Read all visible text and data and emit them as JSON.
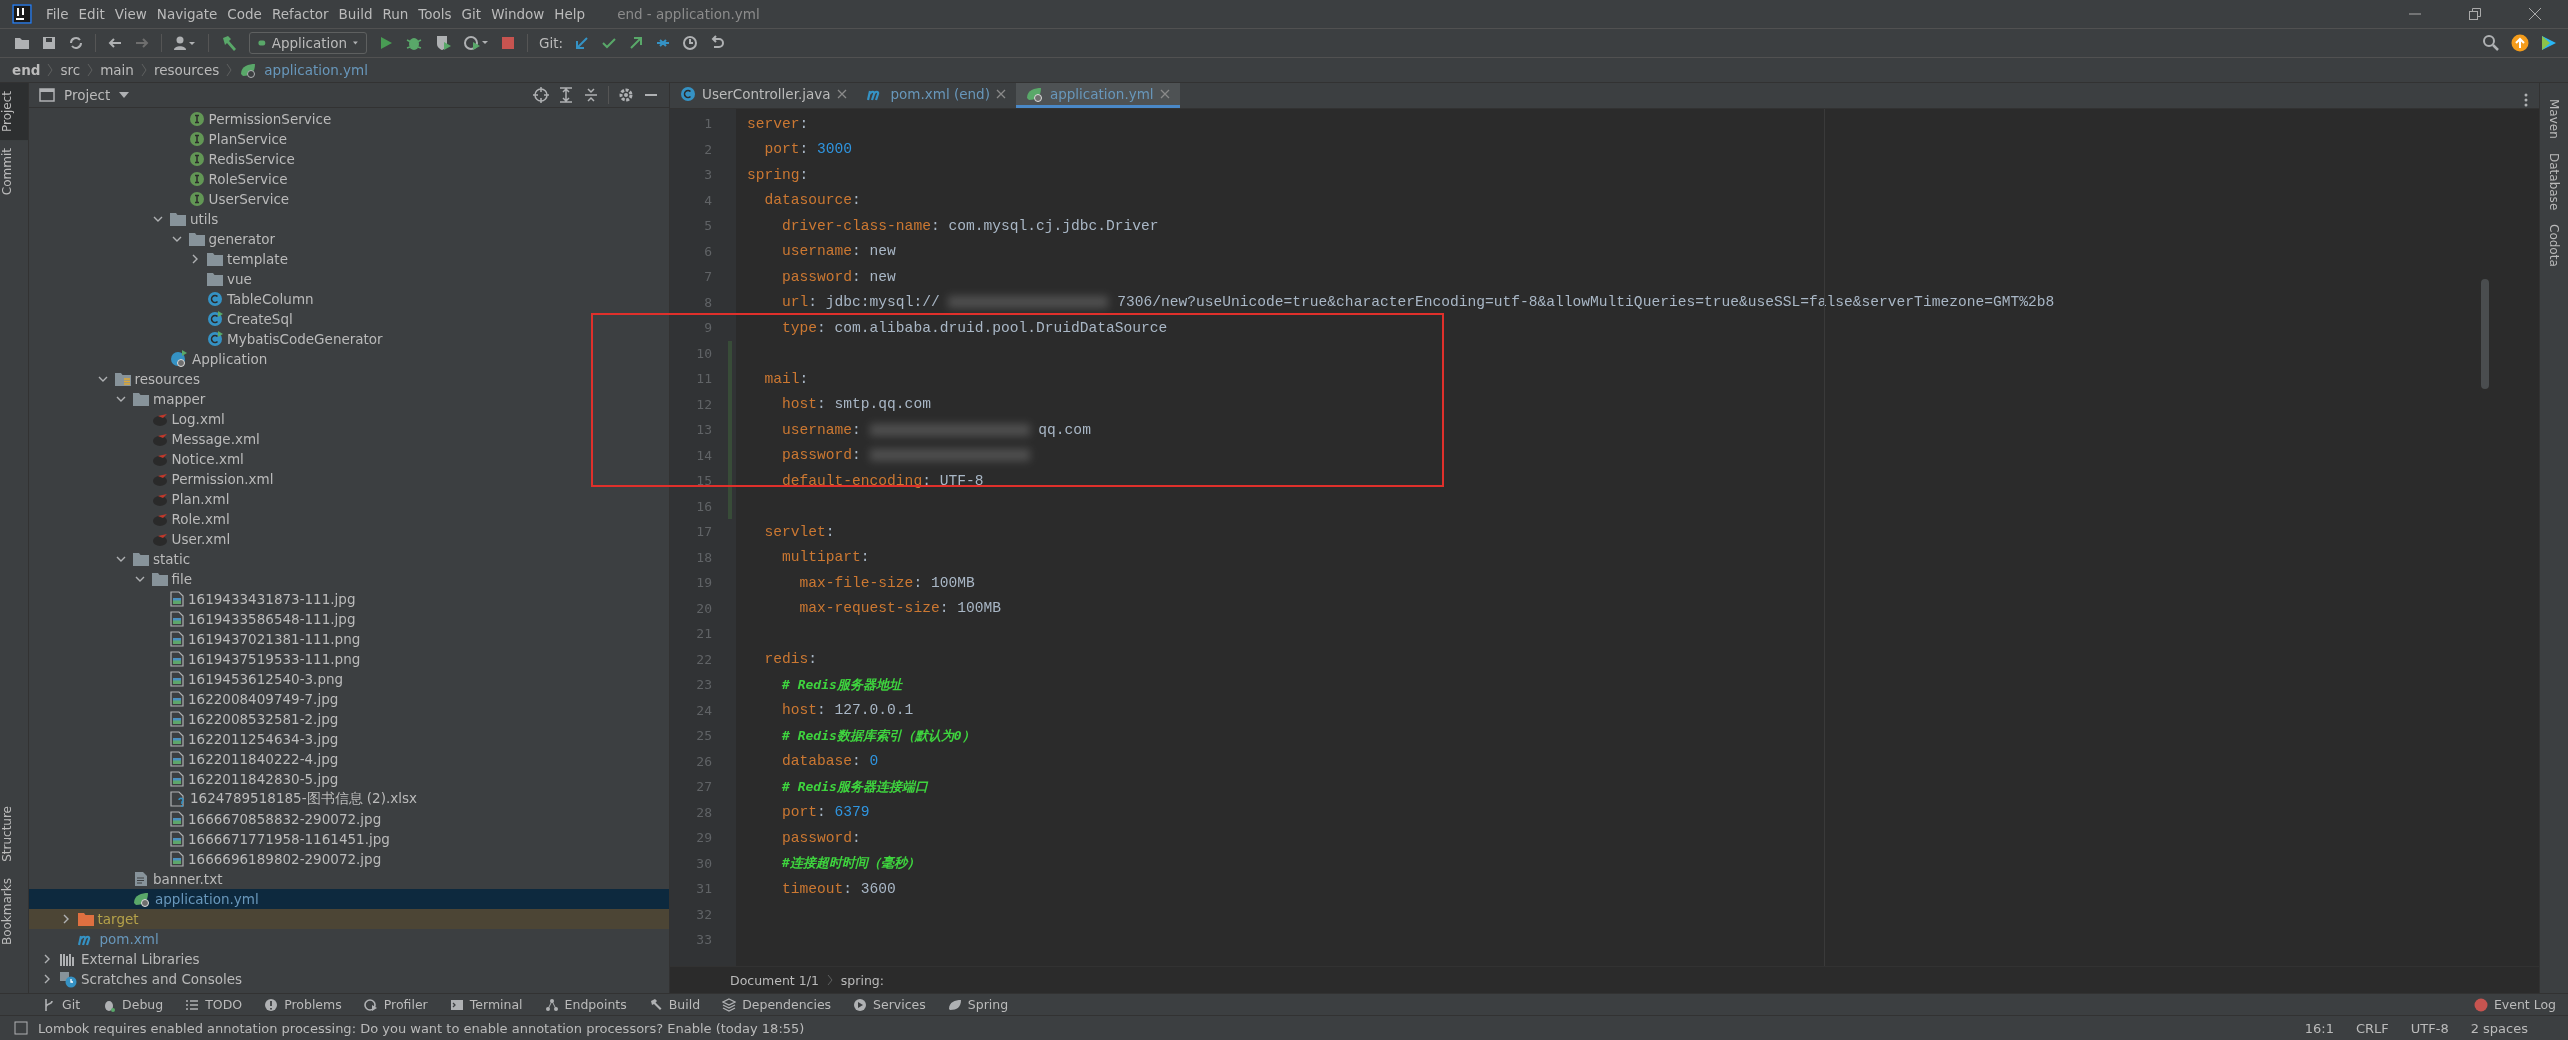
{
  "window": {
    "title": "end - application.yml"
  },
  "menu": [
    "File",
    "Edit",
    "View",
    "Navigate",
    "Code",
    "Refactor",
    "Build",
    "Run",
    "Tools",
    "Git",
    "Window",
    "Help"
  ],
  "toolbar": {
    "run_config": "Application",
    "git_label": "Git:"
  },
  "breadcrumb": [
    "end",
    "src",
    "main",
    "resources",
    "application.yml"
  ],
  "left_tabs": [
    {
      "label": "Project",
      "selected": true
    },
    {
      "label": "Commit",
      "selected": false
    }
  ],
  "left_bottom_tabs": [
    "Structure",
    "Bookmarks"
  ],
  "right_tabs": [
    "Maven",
    "Database",
    "Codota"
  ],
  "project_panel": {
    "title": "Project",
    "tree": [
      {
        "children": [
          {
            "children": [
              {
                "children": [
                  {
                    "children": [
                      {
                        "children": [
                          {
                            "children": [
                              {
                                "children": [
                                  {
                                    "label": "PermissionService",
                                    "kind": "interface",
                                    "selected": false,
                                    "modified": false
                                  },
                                  {
                                    "label": "PlanService",
                                    "kind": "interface",
                                    "selected": false,
                                    "modified": false
                                  },
                                  {
                                    "label": "RedisService",
                                    "kind": "interface",
                                    "selected": false,
                                    "modified": false
                                  },
                                  {
                                    "label": "RoleService",
                                    "kind": "interface",
                                    "selected": false,
                                    "modified": false
                                  },
                                  {
                                    "label": "UserService",
                                    "kind": "interface",
                                    "selected": false,
                                    "modified": false
                                  }
                                ]
                              },
                              {
                                "label": "utils",
                                "kind": "folder",
                                "expanded": true,
                                "selected": false,
                                "modified": false,
                                "children": [
                                  {
                                    "label": "generator",
                                    "kind": "folder",
                                    "expanded": true,
                                    "selected": false,
                                    "modified": false,
                                    "children": [
                                      {
                                        "label": "template",
                                        "kind": "folder",
                                        "expanded": false,
                                        "selected": false,
                                        "modified": false
                                      },
                                      {
                                        "label": "vue",
                                        "kind": "folder",
                                        "selected": false,
                                        "modified": false
                                      },
                                      {
                                        "label": "TableColumn",
                                        "kind": "class",
                                        "selected": false,
                                        "modified": false
                                      },
                                      {
                                        "label": "CreateSql",
                                        "kind": "runnable-class",
                                        "selected": false,
                                        "modified": false
                                      },
                                      {
                                        "label": "MybatisCodeGenerator",
                                        "kind": "runnable-class",
                                        "selected": false,
                                        "modified": false
                                      }
                                    ]
                                  }
                                ]
                              },
                              {
                                "label": "Application",
                                "kind": "app-class",
                                "selected": false,
                                "modified": false
                              }
                            ]
                          }
                        ]
                      }
                    ]
                  },
                  {
                    "label": "resources",
                    "kind": "resources-folder",
                    "expanded": true,
                    "selected": false,
                    "modified": false,
                    "children": [
                      {
                        "label": "mapper",
                        "kind": "folder",
                        "expanded": true,
                        "selected": false,
                        "modified": false,
                        "children": [
                          {
                            "label": "Log.xml",
                            "kind": "mybatis-xml",
                            "selected": false,
                            "modified": false
                          },
                          {
                            "label": "Message.xml",
                            "kind": "mybatis-xml",
                            "selected": false,
                            "modified": false
                          },
                          {
                            "label": "Notice.xml",
                            "kind": "mybatis-xml",
                            "selected": false,
                            "modified": false
                          },
                          {
                            "label": "Permission.xml",
                            "kind": "mybatis-xml",
                            "selected": false,
                            "modified": false
                          },
                          {
                            "label": "Plan.xml",
                            "kind": "mybatis-xml",
                            "selected": false,
                            "modified": false
                          },
                          {
                            "label": "Role.xml",
                            "kind": "mybatis-xml",
                            "selected": false,
                            "modified": false
                          },
                          {
                            "label": "User.xml",
                            "kind": "mybatis-xml",
                            "selected": false,
                            "modified": false
                          }
                        ]
                      },
                      {
                        "label": "static",
                        "kind": "folder",
                        "expanded": true,
                        "selected": false,
                        "modified": false,
                        "children": [
                          {
                            "label": "file",
                            "kind": "folder",
                            "expanded": true,
                            "selected": false,
                            "modified": false,
                            "children": [
                              {
                                "label": "1619433431873-111.jpg",
                                "kind": "image",
                                "selected": false,
                                "modified": false
                              },
                              {
                                "label": "1619433586548-111.jpg",
                                "kind": "image",
                                "selected": false,
                                "modified": false
                              },
                              {
                                "label": "1619437021381-111.png",
                                "kind": "image",
                                "selected": false,
                                "modified": false
                              },
                              {
                                "label": "1619437519533-111.png",
                                "kind": "image",
                                "selected": false,
                                "modified": false
                              },
                              {
                                "label": "1619453612540-3.png",
                                "kind": "image",
                                "selected": false,
                                "modified": false
                              },
                              {
                                "label": "1622008409749-7.jpg",
                                "kind": "image",
                                "selected": false,
                                "modified": false
                              },
                              {
                                "label": "1622008532581-2.jpg",
                                "kind": "image",
                                "selected": false,
                                "modified": false
                              },
                              {
                                "label": "1622011254634-3.jpg",
                                "kind": "image",
                                "selected": false,
                                "modified": false
                              },
                              {
                                "label": "1622011840222-4.jpg",
                                "kind": "image",
                                "selected": false,
                                "modified": false
                              },
                              {
                                "label": "1622011842830-5.jpg",
                                "kind": "image",
                                "selected": false,
                                "modified": false
                              },
                              {
                                "label": "1624789518185-图书信息 (2).xlsx",
                                "kind": "unknown-file",
                                "selected": false,
                                "modified": false
                              },
                              {
                                "label": "1666670858832-290072.jpg",
                                "kind": "image",
                                "selected": false,
                                "modified": false
                              },
                              {
                                "label": "1666671771958-1161451.jpg",
                                "kind": "image",
                                "selected": false,
                                "modified": false
                              },
                              {
                                "label": "1666696189802-290072.jpg",
                                "kind": "image",
                                "selected": false,
                                "modified": false
                              }
                            ]
                          }
                        ]
                      },
                      {
                        "label": "banner.txt",
                        "kind": "text",
                        "selected": false,
                        "modified": false
                      },
                      {
                        "label": "application.yml",
                        "kind": "yaml",
                        "selected": true,
                        "modified": true
                      }
                    ]
                  }
                ]
              }
            ]
          },
          {
            "label": "target",
            "kind": "excluded-folder",
            "expanded": false,
            "selected": false,
            "modified": false
          },
          {
            "label": "pom.xml",
            "kind": "maven",
            "selected": false,
            "modified": true
          }
        ]
      },
      {
        "label": "External Libraries",
        "kind": "libraries",
        "expanded": false,
        "selected": false,
        "modified": false
      },
      {
        "label": "Scratches and Consoles",
        "kind": "scratches",
        "expanded": false,
        "selected": false,
        "modified": false
      }
    ]
  },
  "editor_tabs": [
    {
      "label": "UserController.java",
      "kind": "java",
      "selected": false,
      "modified": false
    },
    {
      "label": "pom.xml (end)",
      "kind": "maven",
      "selected": false,
      "modified": true
    },
    {
      "label": "application.yml",
      "kind": "yaml",
      "selected": true,
      "modified": true
    }
  ],
  "code": [
    {
      "number": "1",
      "changed": false,
      "tokens": [
        {
          "kind": "key",
          "text": "server"
        },
        {
          "kind": "punct",
          "text": ":"
        }
      ],
      "children": [
        {
          "number": "2",
          "changed": false,
          "tokens": [
            {
              "kind": "key",
              "text": "port"
            },
            {
              "kind": "punct",
              "text": ":"
            },
            {
              "kind": "number",
              "text": "3000"
            }
          ]
        }
      ]
    },
    {
      "number": "3",
      "changed": false,
      "tokens": [
        {
          "kind": "key",
          "text": "spring"
        },
        {
          "kind": "punct",
          "text": ":"
        }
      ],
      "children": [
        {
          "number": "4",
          "changed": false,
          "tokens": [
            {
              "kind": "key",
              "text": "datasource"
            },
            {
              "kind": "punct",
              "text": ":"
            }
          ],
          "children": [
            {
              "number": "5",
              "changed": false,
              "tokens": [
                {
                  "kind": "key",
                  "text": "driver-class-name"
                },
                {
                  "kind": "punct",
                  "text": ":"
                },
                {
                  "kind": "string",
                  "text": "com.mysql.cj.jdbc.Driver"
                }
              ]
            },
            {
              "number": "6",
              "changed": false,
              "tokens": [
                {
                  "kind": "key",
                  "text": "username"
                },
                {
                  "kind": "punct",
                  "text": ":"
                },
                {
                  "kind": "string",
                  "text": "new"
                }
              ]
            },
            {
              "number": "7",
              "changed": false,
              "tokens": [
                {
                  "kind": "key",
                  "text": "password"
                },
                {
                  "kind": "punct",
                  "text": ":"
                },
                {
                  "kind": "string",
                  "text": "new"
                }
              ]
            },
            {
              "number": "8",
              "changed": false,
              "tokens": [
                {
                  "kind": "key",
                  "text": "url"
                },
                {
                  "kind": "punct",
                  "text": ":"
                },
                {
                  "kind": "string",
                  "text": "jdbc:mysql://"
                },
                {
                  "kind": "blur"
                },
                {
                  "kind": "string",
                  "text": "7306/new?useUnicode=true&characterEncoding=utf-8&allowMultiQueries=true&useSSL=false&serverTimezone=GMT%2b8"
                }
              ]
            },
            {
              "number": "9",
              "changed": false,
              "tokens": [
                {
                  "kind": "key",
                  "text": "type"
                },
                {
                  "kind": "punct",
                  "text": ":"
                },
                {
                  "kind": "string",
                  "text": "com.alibaba.druid.pool.DruidDataSource"
                }
              ]
            }
          ]
        },
        {
          "number": "10",
          "changed": true
        },
        {
          "number": "11",
          "changed": true,
          "tokens": [
            {
              "kind": "key",
              "text": "mail"
            },
            {
              "kind": "punct",
              "text": ":"
            }
          ],
          "children": [
            {
              "number": "12",
              "changed": true,
              "tokens": [
                {
                  "kind": "key",
                  "text": "host"
                },
                {
                  "kind": "punct",
                  "text": ":"
                },
                {
                  "kind": "string",
                  "text": "smtp.qq.com"
                }
              ]
            },
            {
              "number": "13",
              "changed": true,
              "tokens": [
                {
                  "kind": "key",
                  "text": "username"
                },
                {
                  "kind": "punct",
                  "text": ":"
                },
                {
                  "kind": "blur"
                },
                {
                  "kind": "string",
                  "text": "qq.com"
                }
              ]
            },
            {
              "number": "14",
              "changed": true,
              "tokens": [
                {
                  "kind": "key",
                  "text": "password"
                },
                {
                  "kind": "punct",
                  "text": ":"
                },
                {
                  "kind": "blur"
                }
              ]
            },
            {
              "number": "15",
              "changed": true,
              "tokens": [
                {
                  "kind": "key",
                  "text": "default-encoding"
                },
                {
                  "kind": "punct",
                  "text": ":"
                },
                {
                  "kind": "string",
                  "text": "UTF-8"
                }
              ]
            }
          ]
        },
        {
          "number": "16",
          "changed": true
        },
        {
          "number": "17",
          "changed": false,
          "tokens": [
            {
              "kind": "key",
              "text": "servlet"
            },
            {
              "kind": "punct",
              "text": ":"
            }
          ],
          "children": [
            {
              "number": "18",
              "changed": false,
              "tokens": [
                {
                  "kind": "key",
                  "text": "multipart"
                },
                {
                  "kind": "punct",
                  "text": ":"
                }
              ],
              "children": [
                {
                  "number": "19",
                  "changed": false,
                  "tokens": [
                    {
                      "kind": "key",
                      "text": "max-file-size"
                    },
                    {
                      "kind": "punct",
                      "text": ":"
                    },
                    {
                      "kind": "string",
                      "text": "100MB"
                    }
                  ]
                },
                {
                  "number": "20",
                  "changed": false,
                  "tokens": [
                    {
                      "kind": "key",
                      "text": "max-request-size"
                    },
                    {
                      "kind": "punct",
                      "text": ":"
                    },
                    {
                      "kind": "string",
                      "text": "100MB"
                    }
                  ]
                }
              ]
            }
          ]
        },
        {
          "number": "21",
          "changed": false
        },
        {
          "number": "22",
          "changed": false,
          "tokens": [
            {
              "kind": "key",
              "text": "redis"
            },
            {
              "kind": "punct",
              "text": ":"
            }
          ],
          "children": [
            {
              "number": "23",
              "changed": false,
              "tokens": [
                {
                  "kind": "comment",
                  "text": "# Redis服务器地址"
                }
              ]
            },
            {
              "number": "24",
              "changed": false,
              "tokens": [
                {
                  "kind": "key",
                  "text": "host"
                },
                {
                  "kind": "punct",
                  "text": ":"
                },
                {
                  "kind": "string",
                  "text": "127.0.0.1"
                }
              ]
            },
            {
              "number": "25",
              "changed": false,
              "tokens": [
                {
                  "kind": "comment",
                  "text": "# Redis数据库索引（默认为0）"
                }
              ]
            },
            {
              "number": "26",
              "changed": false,
              "tokens": [
                {
                  "kind": "key",
                  "text": "database"
                },
                {
                  "kind": "punct",
                  "text": ":"
                },
                {
                  "kind": "number",
                  "text": "0"
                }
              ]
            },
            {
              "number": "27",
              "changed": false,
              "tokens": [
                {
                  "kind": "comment",
                  "text": "# Redis服务器连接端口"
                }
              ]
            },
            {
              "number": "28",
              "changed": false,
              "tokens": [
                {
                  "kind": "key",
                  "text": "port"
                },
                {
                  "kind": "punct",
                  "text": ":"
                },
                {
                  "kind": "number",
                  "text": "6379"
                }
              ]
            },
            {
              "number": "29",
              "changed": false,
              "tokens": [
                {
                  "kind": "key",
                  "text": "password"
                },
                {
                  "kind": "punct",
                  "text": ":"
                }
              ]
            },
            {
              "number": "30",
              "changed": false,
              "tokens": [
                {
                  "kind": "comment",
                  "text": "#连接超时时间（毫秒）"
                }
              ]
            },
            {
              "number": "31",
              "changed": false,
              "tokens": [
                {
                  "kind": "key",
                  "text": "timeout"
                },
                {
                  "kind": "punct",
                  "text": ":"
                },
                {
                  "kind": "string",
                  "text": "3600"
                }
              ]
            }
          ]
        },
        {
          "number": "32",
          "changed": false
        },
        {
          "number": "33",
          "changed": false
        }
      ]
    }
  ],
  "editor_breadcrumb": [
    "Document 1/1",
    "spring:"
  ],
  "tool_windows": [
    {
      "label": "Git",
      "kind": "git"
    },
    {
      "label": "Debug",
      "kind": "debug"
    },
    {
      "label": "TODO",
      "kind": "todo"
    },
    {
      "label": "Problems",
      "kind": "problems"
    },
    {
      "label": "Profiler",
      "kind": "profiler"
    },
    {
      "label": "Terminal",
      "kind": "terminal"
    },
    {
      "label": "Endpoints",
      "kind": "endpoints"
    },
    {
      "label": "Build",
      "kind": "build"
    },
    {
      "label": "Dependencies",
      "kind": "dependencies"
    },
    {
      "label": "Services",
      "kind": "services"
    },
    {
      "label": "Spring",
      "kind": "spring"
    }
  ],
  "event_log": "Event Log",
  "status_bar": {
    "message": "Lombok requires enabled annotation processing: Do you want to enable annotation processors? Enable (today 18:55)",
    "items": [
      "16:1",
      "CRLF",
      "UTF-8",
      "2 spaces"
    ]
  }
}
